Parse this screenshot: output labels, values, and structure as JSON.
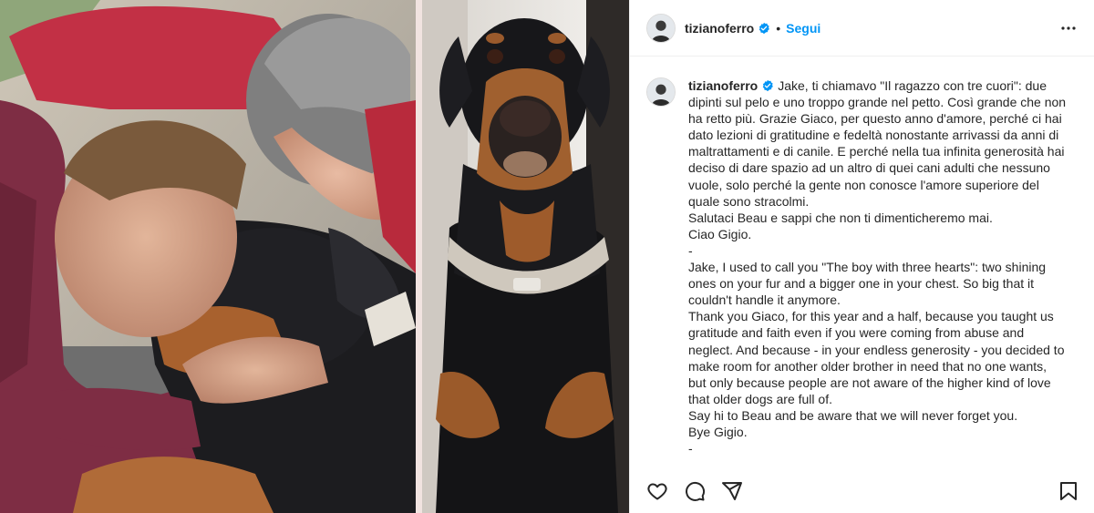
{
  "post": {
    "username": "tizianoferro",
    "follow_label": "Segui",
    "separator": "•"
  },
  "caption": {
    "username": "tizianoferro",
    "lines": [
      "Jake, ti chiamavo \"Il ragazzo con tre cuori\": due",
      "dipinti sul pelo e uno troppo grande nel petto. Così grande che non",
      "ha retto più. Grazie Giaco, per questo anno d'amore, perché ci hai",
      "dato lezioni di gratitudine e fedeltà nonostante arrivassi da anni di",
      "maltrattamenti e di canile. E perché nella tua infinita generosità hai",
      "deciso di dare spazio ad un altro di quei cani adulti che nessuno",
      "vuole, solo perché la gente non conosce l'amore superiore del",
      "quale sono stracolmi.",
      "Salutaci Beau e sappi che non ti dimenticheremo mai.",
      "Ciao Gigio.",
      "-",
      "Jake, I used to call you \"The boy with three hearts\": two shining",
      "ones on your fur and a bigger one in your chest. So big that it",
      "couldn't handle it anymore.",
      "Thank you Giaco, for this year and a half, because you taught us",
      "gratitude and faith even if you were coming from abuse and",
      "neglect. And because - in your endless generosity - you decided to",
      "make room for another older brother in need that no one wants,",
      "but only because people are not aware of the higher kind of love",
      "that older dogs are full of.",
      "Say hi to Beau and be aware that we will never forget you.",
      "Bye Gigio.",
      "-"
    ]
  },
  "colors": {
    "accent": "#0095f6",
    "verified": "#0095f6",
    "text": "#262626",
    "border": "#efefef"
  },
  "icons": {
    "like": "heart-icon",
    "comment": "comment-icon",
    "share": "share-icon",
    "save": "bookmark-icon",
    "more": "more-options-icon",
    "verified": "verified-badge-icon"
  }
}
